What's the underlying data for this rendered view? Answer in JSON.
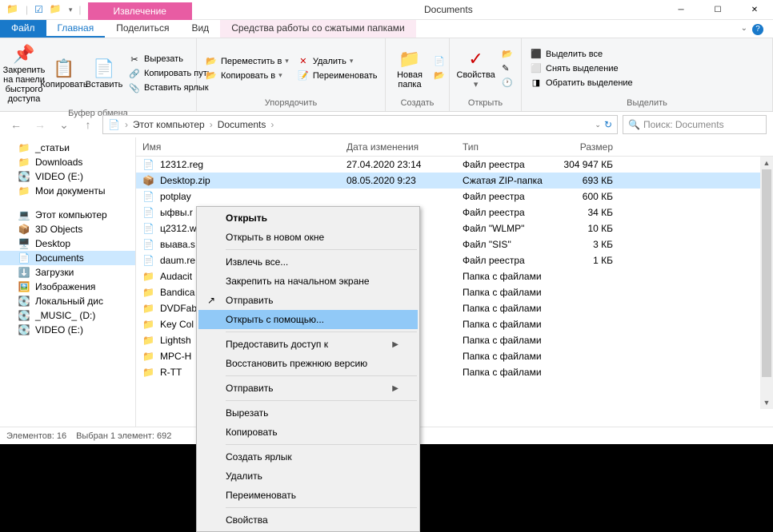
{
  "window": {
    "contextual_tab": "Извлечение",
    "title": "Documents"
  },
  "tabs": {
    "file": "Файл",
    "home": "Главная",
    "share": "Поделиться",
    "view": "Вид",
    "compressed": "Средства работы со сжатыми папками"
  },
  "ribbon": {
    "clipboard": {
      "pin": "Закрепить на панели быстрого доступа",
      "copy": "Копировать",
      "paste": "Вставить",
      "cut": "Вырезать",
      "copy_path": "Копировать путь",
      "paste_shortcut": "Вставить ярлык",
      "label": "Буфер обмена"
    },
    "organize": {
      "move_to": "Переместить в",
      "copy_to": "Копировать в",
      "delete": "Удалить",
      "rename": "Переименовать",
      "label": "Упорядочить"
    },
    "new": {
      "new_folder": "Новая папка",
      "label": "Создать"
    },
    "open": {
      "properties": "Свойства",
      "label": "Открыть"
    },
    "select": {
      "select_all": "Выделить все",
      "select_none": "Снять выделение",
      "invert": "Обратить выделение",
      "label": "Выделить"
    }
  },
  "breadcrumb": {
    "this_pc": "Этот компьютер",
    "folder": "Documents"
  },
  "search": {
    "placeholder": "Поиск: Documents"
  },
  "nav": [
    {
      "icon": "📁",
      "label": "_статьи"
    },
    {
      "icon": "📁",
      "label": "Downloads"
    },
    {
      "icon": "💽",
      "label": "VIDEO (E:)"
    },
    {
      "icon": "📁",
      "label": "Мои документы"
    }
  ],
  "nav2": [
    {
      "icon": "💻",
      "label": "Этот компьютер"
    },
    {
      "icon": "📦",
      "label": "3D Objects"
    },
    {
      "icon": "🖥️",
      "label": "Desktop"
    },
    {
      "icon": "📄",
      "label": "Documents",
      "selected": true
    },
    {
      "icon": "⬇️",
      "label": "Загрузки"
    },
    {
      "icon": "🖼️",
      "label": "Изображения"
    },
    {
      "icon": "💽",
      "label": "Локальный дис"
    },
    {
      "icon": "💽",
      "label": "_MUSIC_ (D:)"
    },
    {
      "icon": "💽",
      "label": "VIDEO (E:)"
    }
  ],
  "columns": {
    "name": "Имя",
    "date": "Дата изменения",
    "type": "Тип",
    "size": "Размер"
  },
  "files": [
    {
      "icon": "📄",
      "name": "12312.reg",
      "date": "27.04.2020 23:14",
      "type": "Файл реестра",
      "size": "304 947 КБ"
    },
    {
      "icon": "📦",
      "name": "Desktop.zip",
      "date": "08.05.2020 9:23",
      "type": "Сжатая ZIP-папка",
      "size": "693 КБ",
      "selected": true
    },
    {
      "icon": "📄",
      "name": "potplay",
      "date": "",
      "type": "Файл реестра",
      "size": "600 КБ"
    },
    {
      "icon": "📄",
      "name": "ыфвы.r",
      "date": "",
      "type": "Файл реестра",
      "size": "34 КБ"
    },
    {
      "icon": "📄",
      "name": "ц2312.w",
      "date": "",
      "type": "Файл \"WLMP\"",
      "size": "10 КБ"
    },
    {
      "icon": "📄",
      "name": "выава.s",
      "date": "",
      "type": "Файл \"SIS\"",
      "size": "3 КБ"
    },
    {
      "icon": "📄",
      "name": "daum.re",
      "date": "",
      "type": "Файл реестра",
      "size": "1 КБ"
    },
    {
      "icon": "📁",
      "name": "Audacit",
      "date": "",
      "type": "Папка с файлами",
      "size": ""
    },
    {
      "icon": "📁",
      "name": "Bandica",
      "date": "",
      "type": "Папка с файлами",
      "size": ""
    },
    {
      "icon": "📁",
      "name": "DVDFab",
      "date": "",
      "type": "Папка с файлами",
      "size": ""
    },
    {
      "icon": "📁",
      "name": "Key Col",
      "date": "",
      "type": "Папка с файлами",
      "size": ""
    },
    {
      "icon": "📁",
      "name": "Lightsh",
      "date": "",
      "type": "Папка с файлами",
      "size": ""
    },
    {
      "icon": "📁",
      "name": "MPC-H",
      "date": "",
      "type": "Папка с файлами",
      "size": ""
    },
    {
      "icon": "📁",
      "name": "R-TT",
      "date": "",
      "type": "Папка с файлами",
      "size": ""
    }
  ],
  "context_menu": [
    {
      "label": "Открыть",
      "bold": true
    },
    {
      "label": "Открыть в новом окне"
    },
    {
      "sep": true
    },
    {
      "label": "Извлечь все..."
    },
    {
      "label": "Закрепить на начальном экране"
    },
    {
      "label": "Отправить",
      "icon": "↗"
    },
    {
      "label": "Открыть с помощью...",
      "highlighted": true
    },
    {
      "sep": true
    },
    {
      "label": "Предоставить доступ к",
      "arrow": true
    },
    {
      "label": "Восстановить прежнюю версию"
    },
    {
      "sep": true
    },
    {
      "label": "Отправить",
      "arrow": true
    },
    {
      "sep": true
    },
    {
      "label": "Вырезать"
    },
    {
      "label": "Копировать"
    },
    {
      "sep": true
    },
    {
      "label": "Создать ярлык"
    },
    {
      "label": "Удалить"
    },
    {
      "label": "Переименовать"
    },
    {
      "sep": true
    },
    {
      "label": "Свойства"
    }
  ],
  "status": {
    "count": "Элементов: 16",
    "selection": "Выбран 1 элемент: 692"
  }
}
